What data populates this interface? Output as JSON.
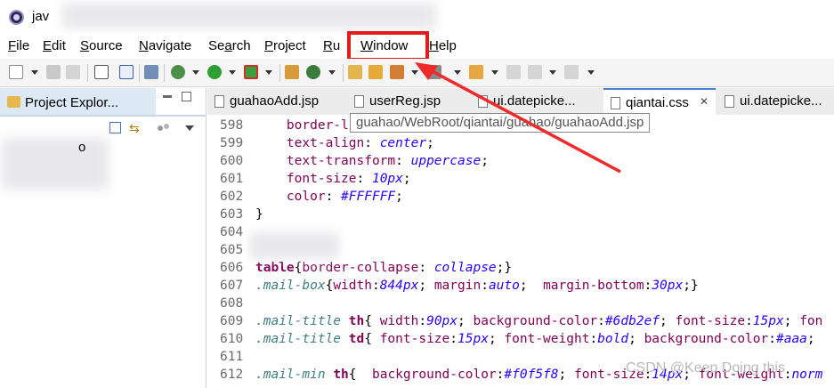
{
  "window": {
    "title": "jav"
  },
  "menu": {
    "items": [
      {
        "pre": "",
        "mn": "F",
        "post": "ile"
      },
      {
        "pre": "",
        "mn": "E",
        "post": "dit"
      },
      {
        "pre": "",
        "mn": "S",
        "post": "ource"
      },
      {
        "pre": "",
        "mn": "N",
        "post": "avigate"
      },
      {
        "pre": "Se",
        "mn": "a",
        "post": "rch"
      },
      {
        "pre": "",
        "mn": "P",
        "post": "roject"
      },
      {
        "pre": "",
        "mn": "R",
        "post": "u"
      },
      {
        "pre": "",
        "mn": "W",
        "post": "indow"
      },
      {
        "pre": "",
        "mn": "H",
        "post": "elp"
      }
    ]
  },
  "explorer": {
    "label": "Project Explor...",
    "tree_item_suffix": "o"
  },
  "editor": {
    "tabs": [
      {
        "label": "guahaoAdd.jsp"
      },
      {
        "label": "userReg.jsp"
      },
      {
        "label": "ui.datepicke..."
      },
      {
        "label": "qiantai.css"
      },
      {
        "label": "ui.datepicke..."
      }
    ],
    "tooltip": "guahao/WebRoot/qiantai/guahao/guahaoAdd.jsp",
    "lines": [
      {
        "n": "598",
        "segs": [
          {
            "t": "    ",
            "c": "plain"
          },
          {
            "t": "border-l",
            "c": "prop"
          },
          {
            "t": "...",
            "c": "struck"
          }
        ]
      },
      {
        "n": "599",
        "segs": [
          {
            "t": "    ",
            "c": "plain"
          },
          {
            "t": "text-align",
            "c": "prop"
          },
          {
            "t": ": ",
            "c": "plain"
          },
          {
            "t": "center",
            "c": "val"
          },
          {
            "t": ";",
            "c": "plain"
          }
        ]
      },
      {
        "n": "600",
        "segs": [
          {
            "t": "    ",
            "c": "plain"
          },
          {
            "t": "text-transform",
            "c": "prop"
          },
          {
            "t": ": ",
            "c": "plain"
          },
          {
            "t": "uppercase",
            "c": "val"
          },
          {
            "t": ";",
            "c": "plain"
          }
        ]
      },
      {
        "n": "601",
        "segs": [
          {
            "t": "    ",
            "c": "plain"
          },
          {
            "t": "font-size",
            "c": "prop"
          },
          {
            "t": ": ",
            "c": "plain"
          },
          {
            "t": "10px",
            "c": "val"
          },
          {
            "t": ";",
            "c": "plain"
          }
        ]
      },
      {
        "n": "602",
        "segs": [
          {
            "t": "    ",
            "c": "plain"
          },
          {
            "t": "color",
            "c": "prop"
          },
          {
            "t": ": ",
            "c": "plain"
          },
          {
            "t": "#FFFFFF",
            "c": "val"
          },
          {
            "t": ";",
            "c": "plain"
          }
        ]
      },
      {
        "n": "603",
        "segs": [
          {
            "t": "}",
            "c": "plain"
          }
        ]
      },
      {
        "n": "604",
        "segs": []
      },
      {
        "n": "605",
        "segs": []
      },
      {
        "n": "606",
        "segs": [
          {
            "t": "table",
            "c": "tag"
          },
          {
            "t": "{",
            "c": "plain"
          },
          {
            "t": "border-collapse",
            "c": "prop"
          },
          {
            "t": ": ",
            "c": "plain"
          },
          {
            "t": "collapse",
            "c": "val"
          },
          {
            "t": ";}",
            "c": "plain"
          }
        ]
      },
      {
        "n": "607",
        "segs": [
          {
            "t": ".mail-box",
            "c": "sel"
          },
          {
            "t": "{",
            "c": "plain"
          },
          {
            "t": "width",
            "c": "prop"
          },
          {
            "t": ":",
            "c": "plain"
          },
          {
            "t": "844px",
            "c": "val"
          },
          {
            "t": "; ",
            "c": "plain"
          },
          {
            "t": "margin",
            "c": "prop"
          },
          {
            "t": ":",
            "c": "plain"
          },
          {
            "t": "auto",
            "c": "val"
          },
          {
            "t": ";  ",
            "c": "plain"
          },
          {
            "t": "margin-bottom",
            "c": "prop"
          },
          {
            "t": ":",
            "c": "plain"
          },
          {
            "t": "30px",
            "c": "val"
          },
          {
            "t": ";}",
            "c": "plain"
          }
        ]
      },
      {
        "n": "608",
        "segs": []
      },
      {
        "n": "609",
        "segs": [
          {
            "t": ".mail-title",
            "c": "sel"
          },
          {
            "t": " ",
            "c": "plain"
          },
          {
            "t": "th",
            "c": "tag"
          },
          {
            "t": "{ ",
            "c": "plain"
          },
          {
            "t": "width",
            "c": "prop"
          },
          {
            "t": ":",
            "c": "plain"
          },
          {
            "t": "90px",
            "c": "val"
          },
          {
            "t": "; ",
            "c": "plain"
          },
          {
            "t": "background-color",
            "c": "prop"
          },
          {
            "t": ":",
            "c": "plain"
          },
          {
            "t": "#6db2ef",
            "c": "val"
          },
          {
            "t": "; ",
            "c": "plain"
          },
          {
            "t": "font-size",
            "c": "prop"
          },
          {
            "t": ":",
            "c": "plain"
          },
          {
            "t": "15px",
            "c": "val"
          },
          {
            "t": "; ",
            "c": "plain"
          },
          {
            "t": "fon",
            "c": "prop"
          }
        ]
      },
      {
        "n": "610",
        "segs": [
          {
            "t": ".mail-title",
            "c": "sel"
          },
          {
            "t": " ",
            "c": "plain"
          },
          {
            "t": "td",
            "c": "tag"
          },
          {
            "t": "{ ",
            "c": "plain"
          },
          {
            "t": "font-size",
            "c": "prop"
          },
          {
            "t": ":",
            "c": "plain"
          },
          {
            "t": "15px",
            "c": "val"
          },
          {
            "t": "; ",
            "c": "plain"
          },
          {
            "t": "font-weight",
            "c": "prop"
          },
          {
            "t": ":",
            "c": "plain"
          },
          {
            "t": "bold",
            "c": "val"
          },
          {
            "t": "; ",
            "c": "plain"
          },
          {
            "t": "background-color",
            "c": "prop"
          },
          {
            "t": ":",
            "c": "plain"
          },
          {
            "t": "#aaa",
            "c": "val"
          },
          {
            "t": ";",
            "c": "plain"
          }
        ]
      },
      {
        "n": "611",
        "segs": []
      },
      {
        "n": "612",
        "segs": [
          {
            "t": ".mail-min",
            "c": "sel"
          },
          {
            "t": " ",
            "c": "plain"
          },
          {
            "t": "th",
            "c": "tag"
          },
          {
            "t": "{  ",
            "c": "plain"
          },
          {
            "t": "background-color",
            "c": "prop"
          },
          {
            "t": ":",
            "c": "plain"
          },
          {
            "t": "#f0f5f8",
            "c": "val"
          },
          {
            "t": "; ",
            "c": "plain"
          },
          {
            "t": "font-size",
            "c": "prop"
          },
          {
            "t": ":",
            "c": "plain"
          },
          {
            "t": "14px",
            "c": "val"
          },
          {
            "t": "; ",
            "c": "plain"
          },
          {
            "t": "font-weight",
            "c": "prop"
          },
          {
            "t": ":",
            "c": "plain"
          },
          {
            "t": "norm",
            "c": "val"
          }
        ]
      }
    ]
  },
  "watermark": "CSDN @Keep Doing this",
  "colors": {
    "highlight": "#e41b1b",
    "active_tab_border": "#4a7fd0"
  }
}
